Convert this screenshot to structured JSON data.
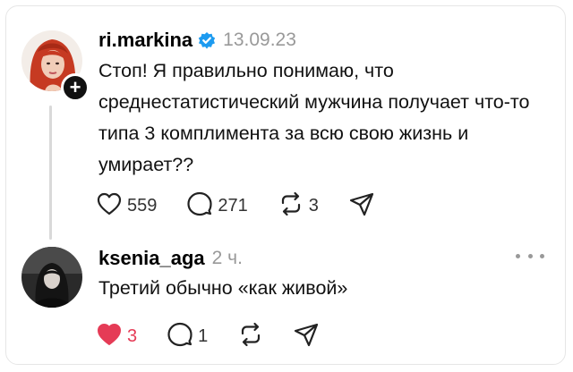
{
  "post": {
    "username": "ri.markina",
    "verified": true,
    "date": "13.09.23",
    "text": "Стоп! Я правильно понимаю, что среднестатистический мужчина получает что-то типа 3 комплимента за всю свою жизнь и умирает??",
    "likes": "559",
    "replies": "271",
    "reposts": "3",
    "icons": [
      "heart-icon",
      "comment-icon",
      "repost-icon",
      "share-icon",
      "plus-icon",
      "verified-badge-icon"
    ]
  },
  "reply": {
    "username": "ksenia_aga",
    "time": "2 ч.",
    "text": "Третий обычно «как живой»",
    "likes": "3",
    "replies": "1",
    "liked": true,
    "icons": [
      "heart-filled-icon",
      "comment-icon",
      "repost-icon",
      "share-icon",
      "more-options-icon"
    ]
  },
  "colors": {
    "verified": "#1d9bf0",
    "like_active": "#e53b56",
    "muted_text": "#999999",
    "thread_line": "#d9d9d9"
  }
}
